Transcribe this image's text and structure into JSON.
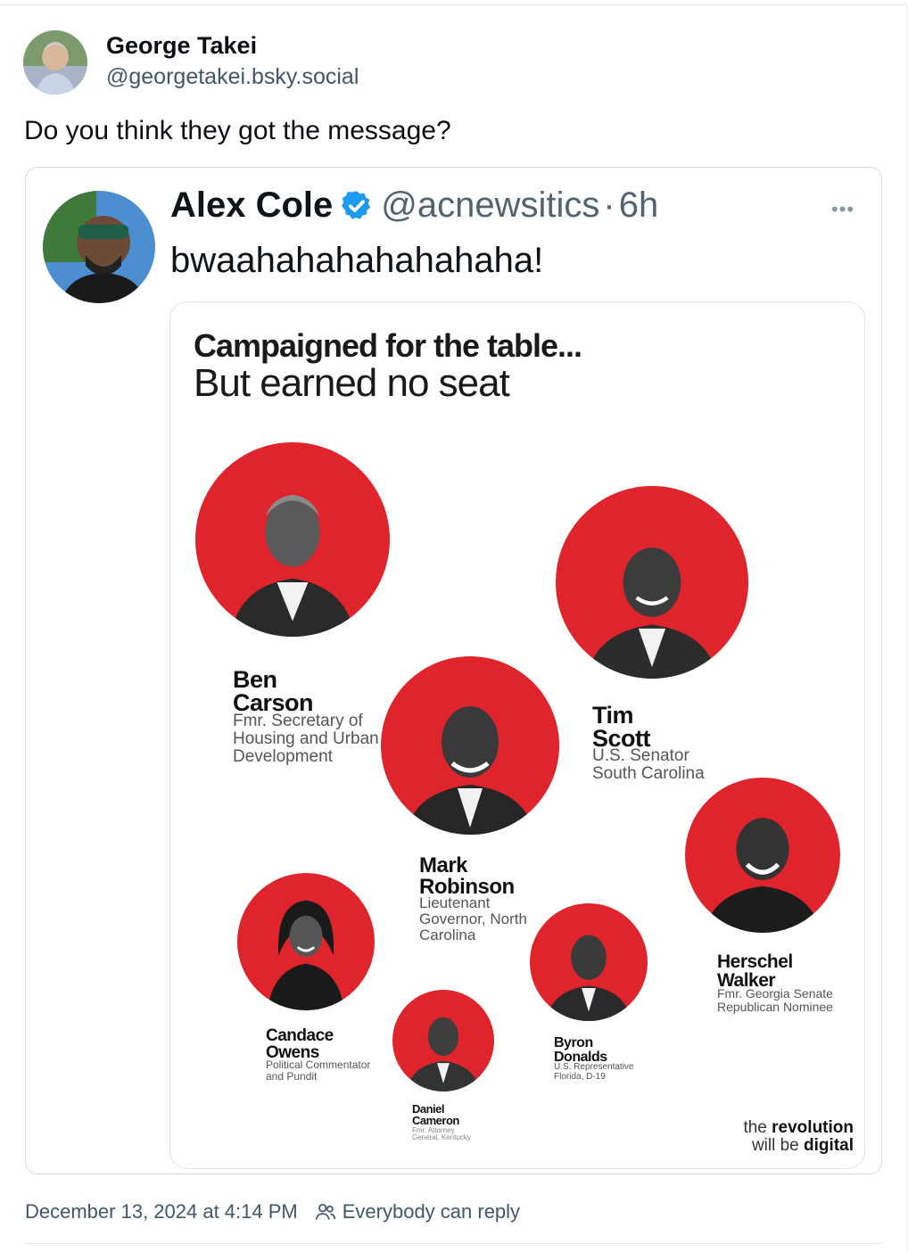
{
  "post": {
    "author_name": "George Takei",
    "author_handle": "@georgetakei.bsky.social",
    "text": "Do you think they got the message?",
    "timestamp": "December 13, 2024 at 4:14 PM",
    "reply_setting": "Everybody can reply"
  },
  "embed": {
    "name": "Alex Cole",
    "handle": "@acnewsitics",
    "dot": "·",
    "time": "6h",
    "text": "bwaahahahahahahaha!",
    "more": "•••"
  },
  "graphic": {
    "title_line1": "Campaigned for the table...",
    "title_line2": "But earned no seat",
    "people": [
      {
        "first": "Ben",
        "last": "Carson",
        "role": "Fmr. Secretary of Housing and Urban Development"
      },
      {
        "first": "Tim",
        "last": "Scott",
        "role": "U.S. Senator South Carolina"
      },
      {
        "first": "Mark",
        "last": "Robinson",
        "role": "Lieutenant Governor, North Carolina"
      },
      {
        "first": "Herschel",
        "last": "Walker",
        "role": "Fmr. Georgia Senate Republican Nominee"
      },
      {
        "first": "Candace",
        "last": "Owens",
        "role": "Political Commentator and Pundit"
      },
      {
        "first": "Byron",
        "last": "Donalds",
        "role": "U.S. Representative Florida, D-19"
      },
      {
        "first": "Daniel",
        "last": "Cameron",
        "role": "Fmr. Attorney General, Kentucky"
      }
    ],
    "brand_line1_prefix": "the",
    "brand_line1_bold": "revolution",
    "brand_line2_prefix": "will be",
    "brand_line2_bold": "digital"
  },
  "colors": {
    "accent_red": "#e0242b",
    "verified_blue": "#1d9bf0",
    "handle_gray": "#42576c"
  },
  "icons": [
    "verified-badge-icon",
    "people-icon",
    "more-options-icon"
  ]
}
